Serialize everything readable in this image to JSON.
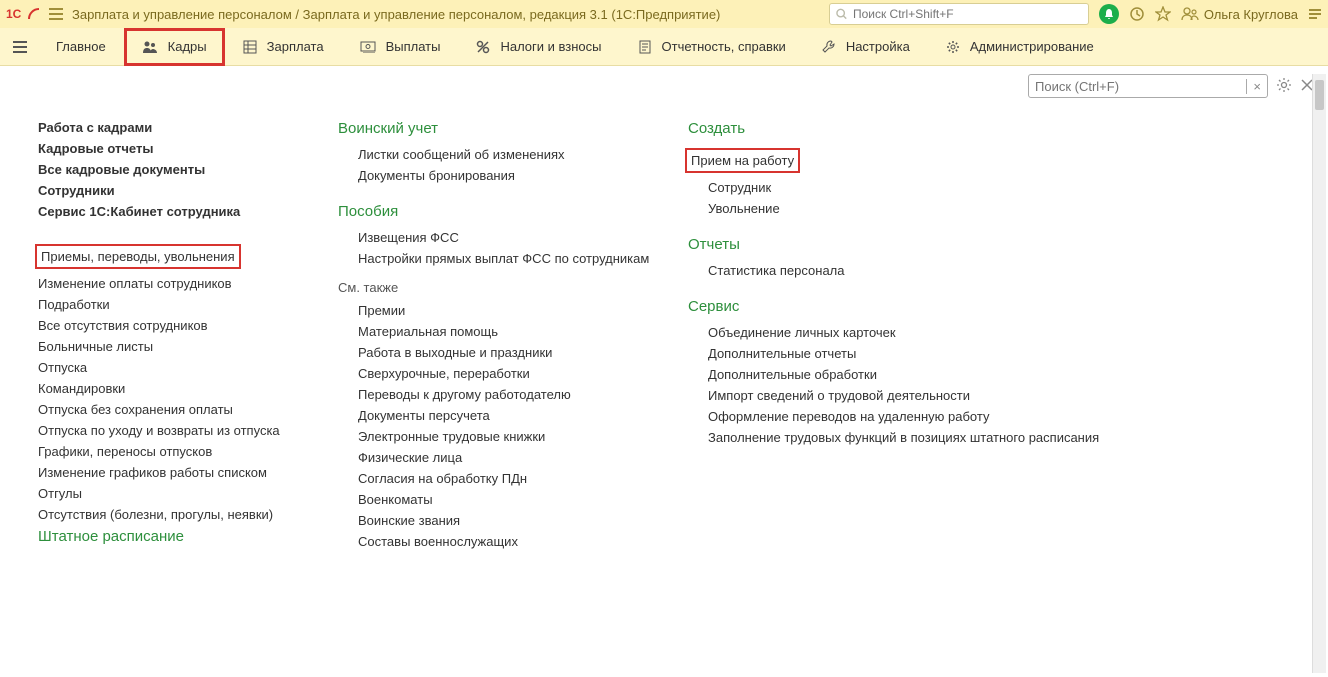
{
  "title": "Зарплата и управление персоналом / Зарплата и управление персоналом, редакция 3.1  (1С:Предприятие)",
  "search_top_placeholder": "Поиск Ctrl+Shift+F",
  "user_name": "Ольга Круглова",
  "menu": {
    "main": "Главное",
    "hr": "Кадры",
    "salary": "Зарплата",
    "payments": "Выплаты",
    "taxes": "Налоги и взносы",
    "reports": "Отчетность, справки",
    "settings": "Настройка",
    "admin": "Администрирование"
  },
  "search_content_placeholder": "Поиск (Ctrl+F)",
  "col1": {
    "items_top": [
      "Работа с кадрами",
      "Кадровые отчеты",
      "Все кадровые документы",
      "Сотрудники",
      "Сервис 1С:Кабинет сотрудника"
    ],
    "highlight": "Приемы, переводы, увольнения",
    "items_bottom": [
      "Изменение оплаты сотрудников",
      "Подработки",
      "Все отсутствия сотрудников",
      "Больничные листы",
      "Отпуска",
      "Командировки",
      "Отпуска без сохранения оплаты",
      "Отпуска по уходу и возвраты из отпуска",
      "Графики, переносы отпусков",
      "Изменение графиков работы списком",
      "Отгулы",
      "Отсутствия (болезни, прогулы, неявки)"
    ],
    "bottom_title": "Штатное расписание"
  },
  "col2": {
    "g1_title": "Воинский учет",
    "g1_items": [
      "Листки сообщений об изменениях",
      "Документы бронирования"
    ],
    "g2_title": "Пособия",
    "g2_items": [
      "Извещения ФСС",
      "Настройки прямых выплат ФСС по сотрудникам"
    ],
    "see_also": "См. также",
    "see_also_items": [
      "Премии",
      "Материальная помощь",
      "Работа в выходные и праздники",
      "Сверхурочные, переработки",
      "Переводы к другому работодателю",
      "Документы персучета",
      "Электронные трудовые книжки",
      "Физические лица",
      "Согласия на обработку ПДн",
      "Военкоматы",
      "Воинские звания",
      "Составы военнослужащих"
    ]
  },
  "col3": {
    "g1_title": "Создать",
    "g1_highlight": "Прием на работу",
    "g1_items": [
      "Сотрудник",
      "Увольнение"
    ],
    "g2_title": "Отчеты",
    "g2_items": [
      "Статистика персонала"
    ],
    "g3_title": "Сервис",
    "g3_items": [
      "Объединение личных карточек",
      "Дополнительные отчеты",
      "Дополнительные обработки",
      "Импорт сведений о трудовой деятельности",
      "Оформление переводов на удаленную работу",
      "Заполнение трудовых функций в позициях штатного расписания"
    ]
  }
}
